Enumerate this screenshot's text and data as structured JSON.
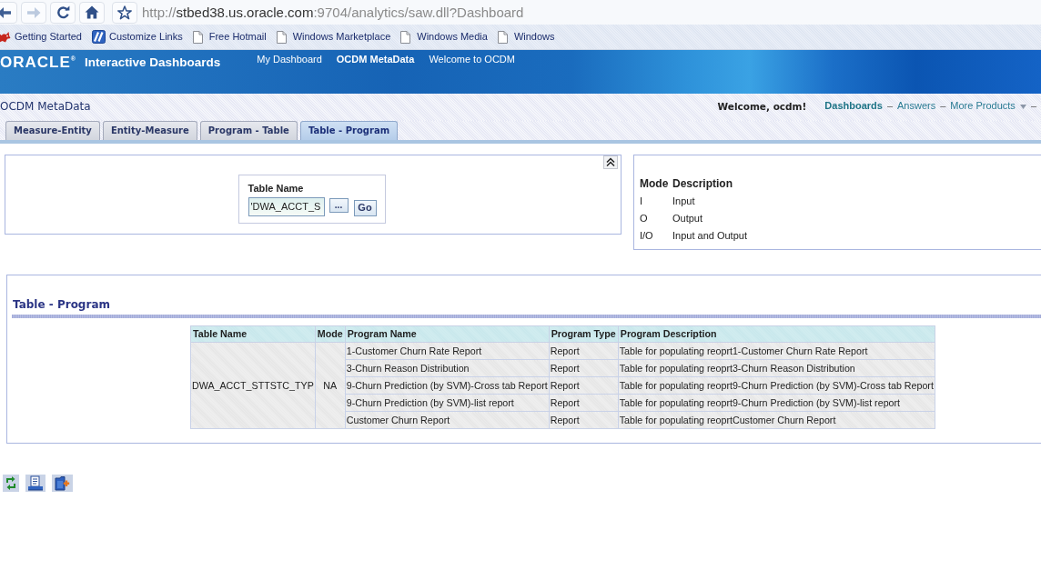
{
  "browser": {
    "nav_buttons": [
      {
        "kind": "back",
        "disabled": false
      },
      {
        "kind": "forward",
        "disabled": true
      },
      {
        "kind": "reload",
        "disabled": false
      },
      {
        "kind": "home",
        "disabled": false
      },
      {
        "kind": "star",
        "disabled": false
      }
    ],
    "address": {
      "scheme": "http://",
      "host": "stbed38.us.oracle.com",
      "path": ":9704/analytics/saw.dll?Dashboard"
    },
    "bookmarks": [
      {
        "kind": "fox",
        "label": "Getting Started"
      },
      {
        "kind": "tile",
        "label": "Customize Links"
      },
      {
        "kind": "page",
        "label": "Free Hotmail"
      },
      {
        "kind": "page",
        "label": "Windows Marketplace"
      },
      {
        "kind": "page",
        "label": "Windows Media"
      },
      {
        "kind": "page",
        "label": "Windows"
      }
    ]
  },
  "header": {
    "logo": "ORACLE$^{®}$",
    "title": "Interactive Dashboards",
    "nav": [
      {
        "label": "My Dashboard",
        "selected": false
      },
      {
        "label": "OCDM MetaData",
        "selected": true
      },
      {
        "label": "Welcome to OCDM",
        "selected": false
      }
    ]
  },
  "subheader": {
    "dashboard_name": "OCDM MetaData",
    "welcome": "Welcome, ocdm!",
    "links": [
      {
        "label": "Dashboards",
        "selected": true,
        "menu": false,
        "separator": "–"
      },
      {
        "label": "Answers",
        "selected": false,
        "menu": false,
        "separator": "–"
      },
      {
        "label": "More Products",
        "selected": false,
        "menu": true,
        "separator": "–"
      }
    ]
  },
  "tabs": [
    {
      "label": "Measure-Entity",
      "selected": false
    },
    {
      "label": "Entity-Measure",
      "selected": false
    },
    {
      "label": "Program - Table",
      "selected": false
    },
    {
      "label": "Table - Program",
      "selected": true
    }
  ],
  "prompt": {
    "label": "Table Name",
    "value": "'DWA_ACCT_S",
    "browse_button": "...",
    "go_button": "Go"
  },
  "mode_legend": {
    "columns": [
      "Mode",
      "Description"
    ],
    "rows": [
      {
        "mode": "I",
        "description": "Input"
      },
      {
        "mode": "O",
        "description": "Output"
      },
      {
        "mode": "I/O",
        "description": "Input and Output"
      }
    ]
  },
  "report": {
    "title": "Table - Program",
    "columns": [
      "Table Name",
      "Mode",
      "Program Name",
      "Program Type",
      "Program Description"
    ],
    "rows": [
      {
        "table_name": "DWA_ACCT_STTSTC_TYP",
        "mode": "NA",
        "programs": [
          {
            "program_name": "1-Customer Churn Rate Report",
            "program_type": "Report",
            "program_description": "Table for populating reoprt1-Customer Churn Rate Report"
          },
          {
            "program_name": "3-Churn Reason Distribution",
            "program_type": "Report",
            "program_description": "Table for populating reoprt3-Churn Reason Distribution"
          },
          {
            "program_name": "9-Churn Prediction (by SVM)-Cross tab Report",
            "program_type": "Report",
            "program_description": "Table for populating reoprt9-Churn Prediction (by SVM)-Cross tab Report"
          },
          {
            "program_name": "9-Churn Prediction (by SVM)-list report",
            "program_type": "Report",
            "program_description": "Table for populating reoprt9-Churn Prediction (by SVM)-list report"
          },
          {
            "program_name": "Customer Churn Report",
            "program_type": "Report",
            "program_description": "Table for populating reoprtCustomer Churn Report"
          }
        ]
      }
    ]
  }
}
